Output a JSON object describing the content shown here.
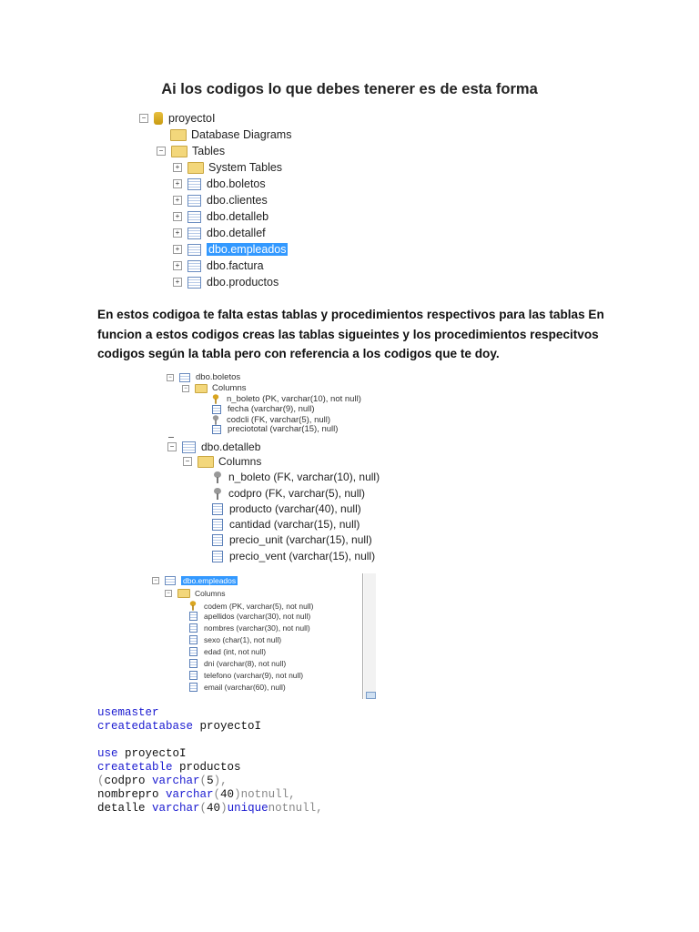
{
  "title": "Ai los codigos lo que debes tenerer es de esta forma",
  "tree1": {
    "db": "proyectoI",
    "diagrams": "Database Diagrams",
    "tables": "Tables",
    "items": [
      "System Tables",
      "dbo.boletos",
      "dbo.clientes",
      "dbo.detalleb",
      "dbo.detallef",
      "dbo.empleados",
      "dbo.factura",
      "dbo.productos"
    ],
    "selected": "dbo.empleados"
  },
  "paragraph": [
    "En estos codigoa te falta estas tablas y procedimientos respectivos para  las tablas En",
    "funcion a estos codigos creas las tablas sigueintes y los procedimientos respecitvos",
    "codigos  según la tabla pero con referencia a los codigos que te doy."
  ],
  "boletos": {
    "name": "dbo.boletos",
    "columns_label": "Columns",
    "columns": [
      "n_boleto (PK, varchar(10), not null)",
      "fecha (varchar(9), null)",
      "codcli (FK, varchar(5), null)",
      "preciototal (varchar(15), null)"
    ]
  },
  "detalleb": {
    "name": "dbo.detalleb",
    "columns_label": "Columns",
    "columns": [
      "n_boleto (FK, varchar(10), null)",
      "codpro (FK, varchar(5), null)",
      "producto (varchar(40), null)",
      "cantidad (varchar(15), null)",
      "precio_unit (varchar(15), null)",
      "precio_vent (varchar(15), null)"
    ]
  },
  "empleados": {
    "name": "dbo.empleados",
    "columns_label": "Columns",
    "columns": [
      "codem (PK, varchar(5), not null)",
      "apellidos (varchar(30), not null)",
      "nombres (varchar(30), not null)",
      "sexo (char(1), not null)",
      "edad (int, not null)",
      "dni (varchar(8), not null)",
      "telefono (varchar(9), not null)",
      "email (varchar(60), null)"
    ]
  },
  "code": [
    [
      [
        "kw",
        "usemaster"
      ]
    ],
    [
      [
        "kw",
        "createdatabase"
      ],
      [
        "tx",
        " proyectoI"
      ]
    ],
    [],
    [
      [
        "kw",
        "use"
      ],
      [
        "tx",
        " proyectoI"
      ]
    ],
    [
      [
        "kw",
        "createtable"
      ],
      [
        "tx",
        " productos"
      ]
    ],
    [
      [
        "pn",
        "("
      ],
      [
        "tx",
        "codpro "
      ],
      [
        "kw",
        "varchar"
      ],
      [
        "pn",
        "("
      ],
      [
        "tx",
        "5"
      ],
      [
        "pn",
        "),"
      ]
    ],
    [
      [
        "tx",
        "nombrepro "
      ],
      [
        "kw",
        "varchar"
      ],
      [
        "pn",
        "("
      ],
      [
        "tx",
        "40"
      ],
      [
        "pn",
        ")notnull,"
      ]
    ],
    [
      [
        "tx",
        "detalle "
      ],
      [
        "kw",
        "varchar"
      ],
      [
        "pn",
        "("
      ],
      [
        "tx",
        "40"
      ],
      [
        "pn",
        ")"
      ],
      [
        "kw",
        "unique"
      ],
      [
        "pn",
        "notnull,"
      ]
    ]
  ]
}
